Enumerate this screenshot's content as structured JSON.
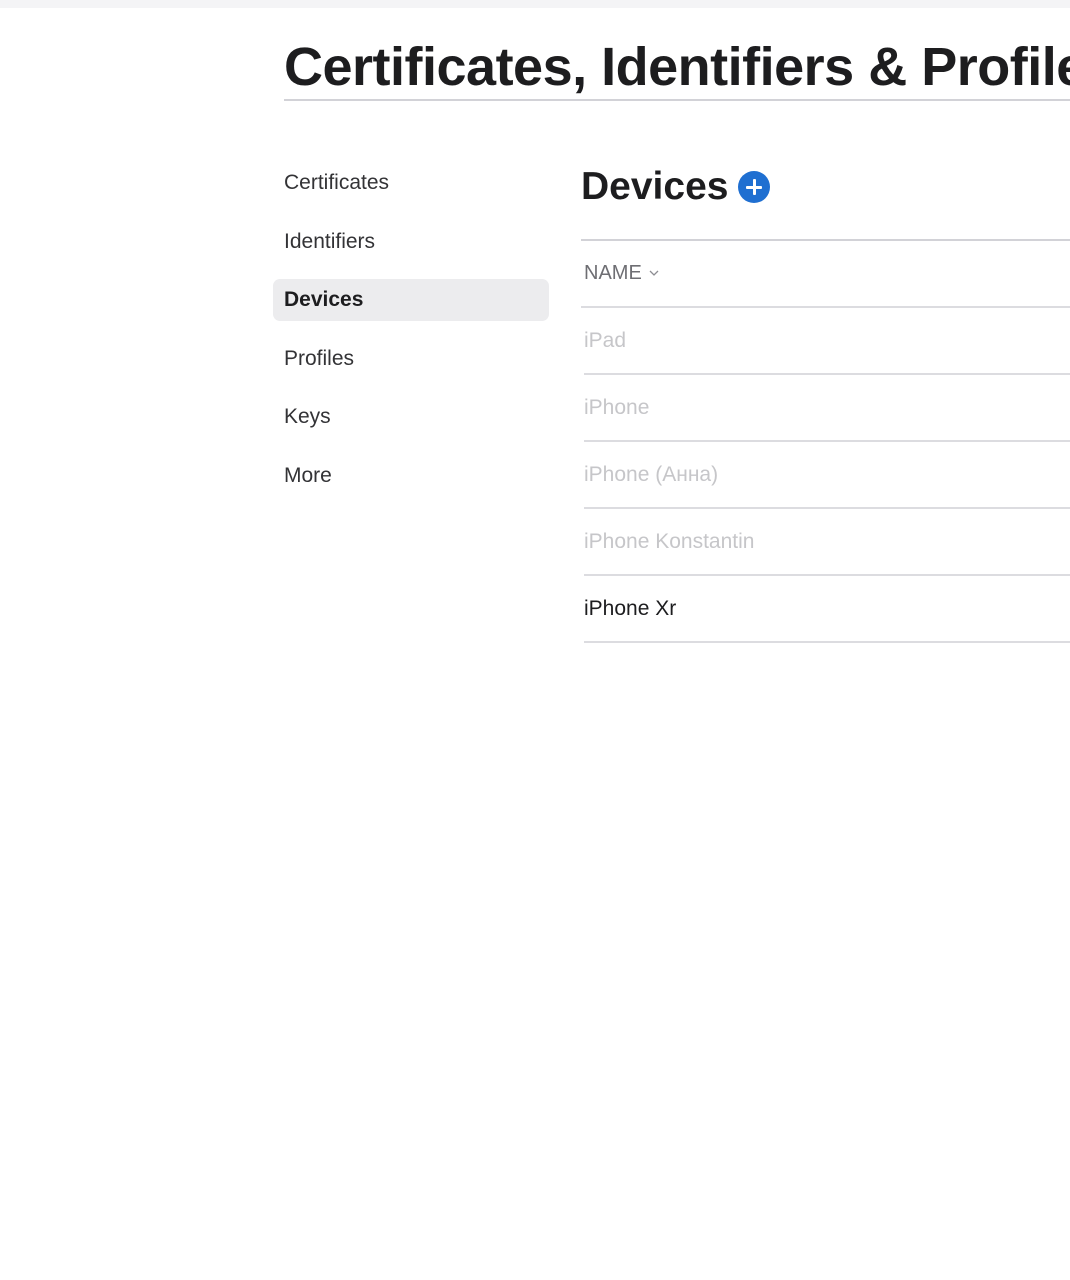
{
  "page": {
    "title": "Certificates, Identifiers & Profiles"
  },
  "sidebar": {
    "items": [
      {
        "label": "Certificates",
        "active": false
      },
      {
        "label": "Identifiers",
        "active": false
      },
      {
        "label": "Devices",
        "active": true
      },
      {
        "label": "Profiles",
        "active": false
      },
      {
        "label": "Keys",
        "active": false
      },
      {
        "label": "More",
        "active": false
      }
    ]
  },
  "main": {
    "section_title": "Devices",
    "add_icon": "plus-circle-icon",
    "accent_color": "#1f6fd1",
    "table": {
      "column_header": "NAME",
      "sort_icon": "chevron-down-icon",
      "rows": [
        {
          "name": "iPad",
          "enabled": false
        },
        {
          "name": "iPhone",
          "enabled": false
        },
        {
          "name": "iPhone (Анна)",
          "enabled": false
        },
        {
          "name": "iPhone Konstantin",
          "enabled": false
        },
        {
          "name": "iPhone Xr",
          "enabled": true
        }
      ]
    }
  }
}
